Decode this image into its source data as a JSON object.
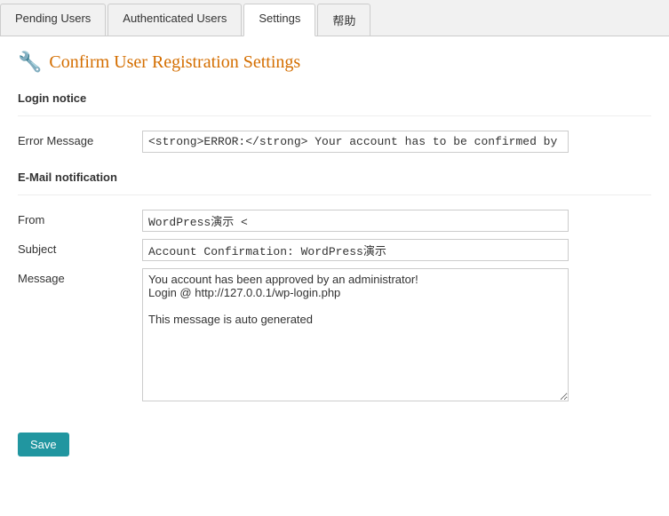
{
  "tabs": [
    {
      "id": "pending-users",
      "label": "Pending Users",
      "active": false
    },
    {
      "id": "authenticated-users",
      "label": "Authenticated Users",
      "active": false
    },
    {
      "id": "settings",
      "label": "Settings",
      "active": true
    },
    {
      "id": "help",
      "label": "帮助",
      "active": false
    }
  ],
  "page": {
    "title": "Confirm User Registration Settings",
    "icon": "🔧"
  },
  "sections": {
    "login_notice": {
      "title": "Login notice",
      "fields": {
        "error_message": {
          "label": "Error Message",
          "value": "<strong>ERROR:</strong> Your account has to be confirmed by an administrator before"
        }
      }
    },
    "email_notification": {
      "title": "E-Mail notification",
      "fields": {
        "from": {
          "label": "From",
          "value": "WordPress演示 <"
        },
        "subject": {
          "label": "Subject",
          "value": "Account Confirmation: WordPress演示"
        },
        "message": {
          "label": "Message",
          "value": "You account has been approved by an administrator!\nLogin @ http://127.0.0.1/wp-login.php\n\nThis message is auto generated"
        }
      }
    }
  },
  "buttons": {
    "save": "Save"
  }
}
